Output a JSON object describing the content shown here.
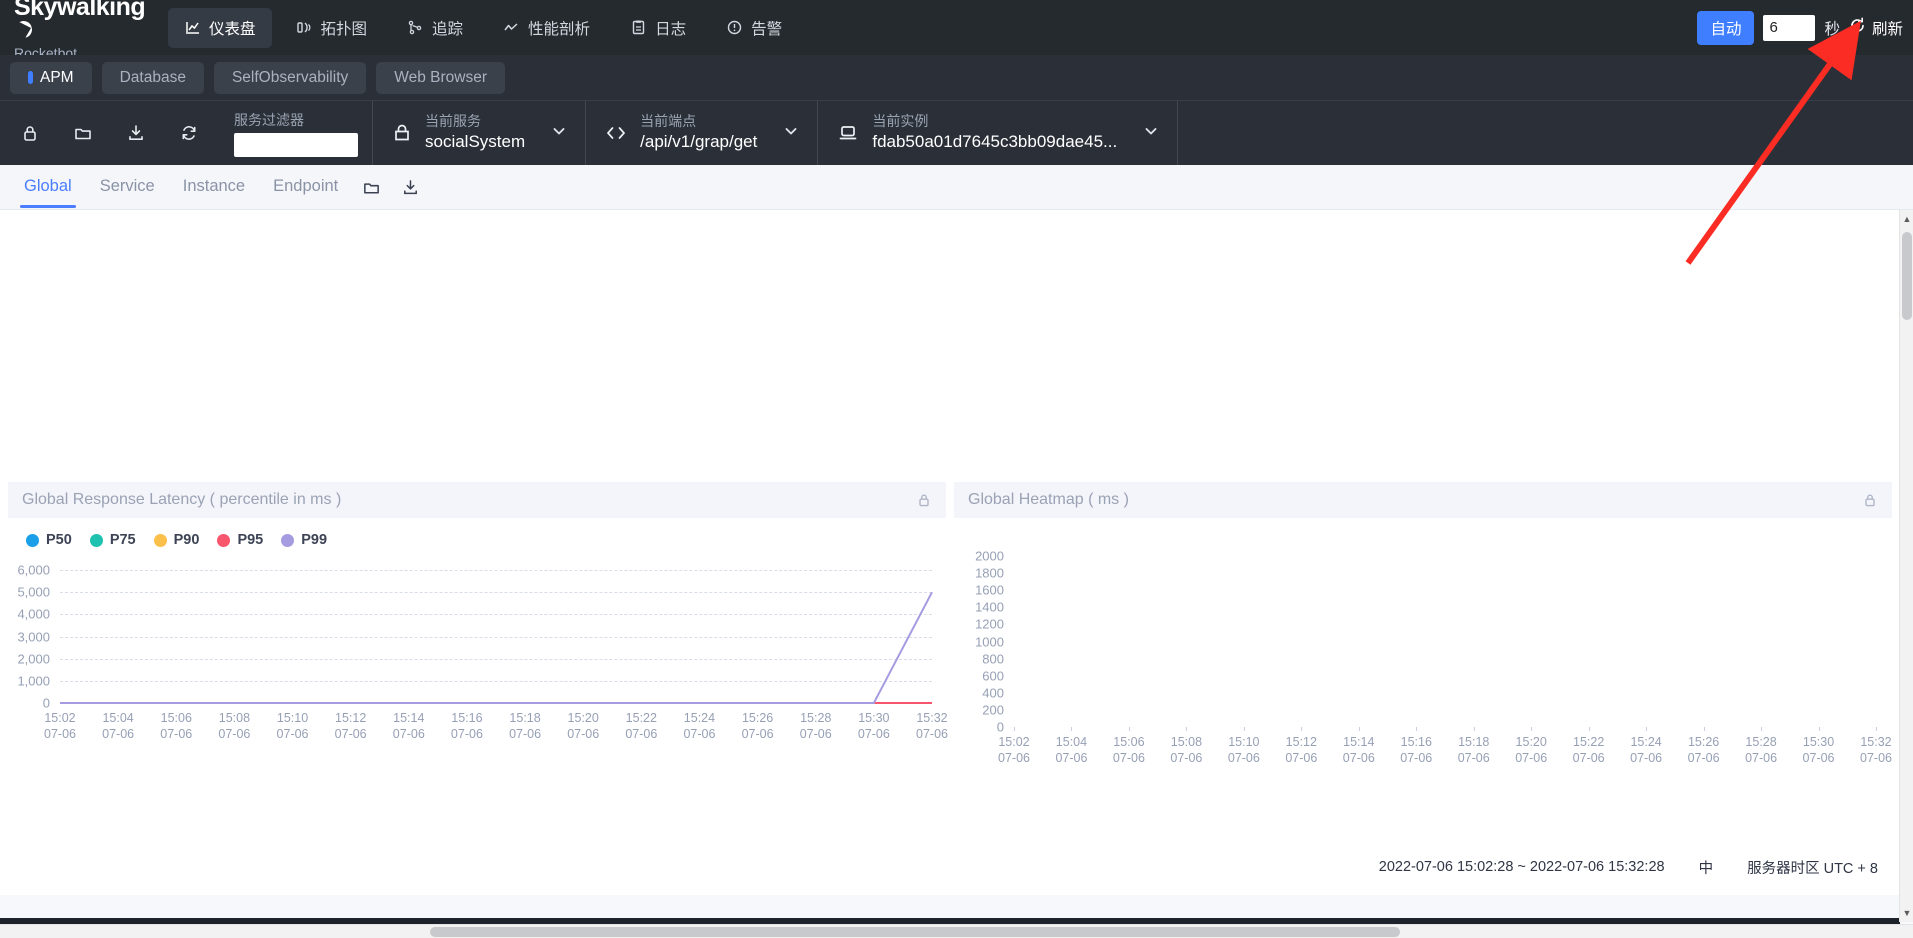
{
  "brand": {
    "name": "Skywalking",
    "sub": "Rocketbot",
    "moon_icon": "moon-icon"
  },
  "topnav": {
    "items": [
      {
        "label": "仪表盘",
        "icon": "dashboard-icon",
        "active": true
      },
      {
        "label": "拓扑图",
        "icon": "topology-icon",
        "active": false
      },
      {
        "label": "追踪",
        "icon": "trace-icon",
        "active": false
      },
      {
        "label": "性能剖析",
        "icon": "profile-icon",
        "active": false
      },
      {
        "label": "日志",
        "icon": "log-icon",
        "active": false
      },
      {
        "label": "告警",
        "icon": "alarm-icon",
        "active": false
      }
    ],
    "auto_label": "自动",
    "interval_value": "6",
    "interval_placeholder": "",
    "seconds_label": "秒",
    "refresh_label": "刷新",
    "refresh_icon": "refresh-icon",
    "accent": "#3e7eff"
  },
  "group_tabs": [
    {
      "label": "APM",
      "active": true
    },
    {
      "label": "Database",
      "active": false
    },
    {
      "label": "SelfObservability",
      "active": false
    },
    {
      "label": "Web Browser",
      "active": false
    }
  ],
  "selector_bar": {
    "tools": [
      {
        "icon": "lock-icon",
        "name": "lock-button"
      },
      {
        "icon": "folder-icon",
        "name": "folder-button"
      },
      {
        "icon": "download-icon",
        "name": "import-button"
      },
      {
        "icon": "sync-icon",
        "name": "reload-button"
      }
    ],
    "filter": {
      "label": "服务过滤器",
      "value": "",
      "placeholder": ""
    },
    "cells": [
      {
        "icon": "service-icon",
        "title": "当前服务",
        "value": "socialSystem",
        "caret": "chevron-down-icon"
      },
      {
        "icon": "endpoint-icon",
        "title": "当前端点",
        "value": "/api/v1/grap/get",
        "caret": "chevron-down-icon"
      },
      {
        "icon": "instance-icon",
        "title": "当前实例",
        "value": "fdab50a01d7645c3bb09dae45...",
        "caret": "chevron-down-icon"
      }
    ]
  },
  "sub_tabs": {
    "items": [
      {
        "label": "Global",
        "active": true
      },
      {
        "label": "Service",
        "active": false
      },
      {
        "label": "Instance",
        "active": false
      },
      {
        "label": "Endpoint",
        "active": false
      }
    ],
    "icons": [
      {
        "icon": "folder-icon",
        "name": "sub-folder-button"
      },
      {
        "icon": "download-icon",
        "name": "sub-export-button"
      }
    ]
  },
  "panels": [
    {
      "title": "Global Response Latency ( percentile in ms )",
      "lock_icon": "lock-icon"
    },
    {
      "title": "Global Heatmap ( ms )",
      "lock_icon": "lock-icon"
    }
  ],
  "status_bar": {
    "time_range": "2022-07-06 15:02:28 ~ 2022-07-06 15:32:28",
    "language": "中",
    "timezone": "服务器时区 UTC + 8"
  },
  "annotation": {
    "type": "arrow",
    "color": "#fb2c23",
    "points_to": "refresh-button"
  },
  "chart_data": [
    {
      "type": "line",
      "title": "Global Response Latency ( percentile in ms )",
      "xlabel": "",
      "ylabel": "",
      "ylim": [
        0,
        6000
      ],
      "yticks": [
        0,
        1000,
        2000,
        3000,
        4000,
        5000,
        6000
      ],
      "ytick_labels": [
        "0",
        "1,000",
        "2,000",
        "3,000",
        "4,000",
        "5,000",
        "6,000"
      ],
      "grid": true,
      "legend_position": "top-left",
      "x": [
        "15:02\n07-06",
        "15:04\n07-06",
        "15:06\n07-06",
        "15:08\n07-06",
        "15:10\n07-06",
        "15:12\n07-06",
        "15:14\n07-06",
        "15:16\n07-06",
        "15:18\n07-06",
        "15:20\n07-06",
        "15:22\n07-06",
        "15:24\n07-06",
        "15:26\n07-06",
        "15:28\n07-06",
        "15:30\n07-06",
        "15:32\n07-06"
      ],
      "xtick_labels": [
        [
          "15:02",
          "07-06"
        ],
        [
          "15:04",
          "07-06"
        ],
        [
          "15:06",
          "07-06"
        ],
        [
          "15:08",
          "07-06"
        ],
        [
          "15:10",
          "07-06"
        ],
        [
          "15:12",
          "07-06"
        ],
        [
          "15:14",
          "07-06"
        ],
        [
          "15:16",
          "07-06"
        ],
        [
          "15:18",
          "07-06"
        ],
        [
          "15:20",
          "07-06"
        ],
        [
          "15:22",
          "07-06"
        ],
        [
          "15:24",
          "07-06"
        ],
        [
          "15:26",
          "07-06"
        ],
        [
          "15:28",
          "07-06"
        ],
        [
          "15:30",
          "07-06"
        ],
        [
          "15:32",
          "07-06"
        ]
      ],
      "series": [
        {
          "name": "P50",
          "color": "#1b9fe8",
          "values": [
            0,
            0,
            0,
            0,
            0,
            0,
            0,
            0,
            0,
            0,
            0,
            0,
            0,
            0,
            0,
            0
          ]
        },
        {
          "name": "P75",
          "color": "#1fc2ae",
          "values": [
            0,
            0,
            0,
            0,
            0,
            0,
            0,
            0,
            0,
            0,
            0,
            0,
            0,
            0,
            0,
            0
          ]
        },
        {
          "name": "P90",
          "color": "#fbc04a",
          "values": [
            0,
            0,
            0,
            0,
            0,
            0,
            0,
            0,
            0,
            0,
            0,
            0,
            0,
            0,
            0,
            0
          ]
        },
        {
          "name": "P95",
          "color": "#f8566c",
          "values": [
            0,
            0,
            0,
            0,
            0,
            0,
            0,
            0,
            0,
            0,
            0,
            0,
            0,
            0,
            0,
            0
          ]
        },
        {
          "name": "P99",
          "color": "#a49be0",
          "values": [
            0,
            0,
            0,
            0,
            0,
            0,
            0,
            0,
            0,
            0,
            0,
            0,
            0,
            0,
            0,
            5000
          ]
        }
      ]
    },
    {
      "type": "heatmap",
      "title": "Global Heatmap ( ms )",
      "xlabel": "",
      "ylabel": "",
      "ylim": [
        0,
        2000
      ],
      "yticks": [
        0,
        200,
        400,
        600,
        800,
        1000,
        1200,
        1400,
        1600,
        1800,
        2000
      ],
      "ytick_labels": [
        "0",
        "200",
        "400",
        "600",
        "800",
        "1000",
        "1200",
        "1400",
        "1600",
        "1800",
        "2000"
      ],
      "grid": false,
      "xtick_labels": [
        [
          "15:02",
          "07-06"
        ],
        [
          "15:04",
          "07-06"
        ],
        [
          "15:06",
          "07-06"
        ],
        [
          "15:08",
          "07-06"
        ],
        [
          "15:10",
          "07-06"
        ],
        [
          "15:12",
          "07-06"
        ],
        [
          "15:14",
          "07-06"
        ],
        [
          "15:16",
          "07-06"
        ],
        [
          "15:18",
          "07-06"
        ],
        [
          "15:20",
          "07-06"
        ],
        [
          "15:22",
          "07-06"
        ],
        [
          "15:24",
          "07-06"
        ],
        [
          "15:26",
          "07-06"
        ],
        [
          "15:28",
          "07-06"
        ],
        [
          "15:30",
          "07-06"
        ],
        [
          "15:32",
          "07-06"
        ]
      ],
      "cells": []
    }
  ]
}
